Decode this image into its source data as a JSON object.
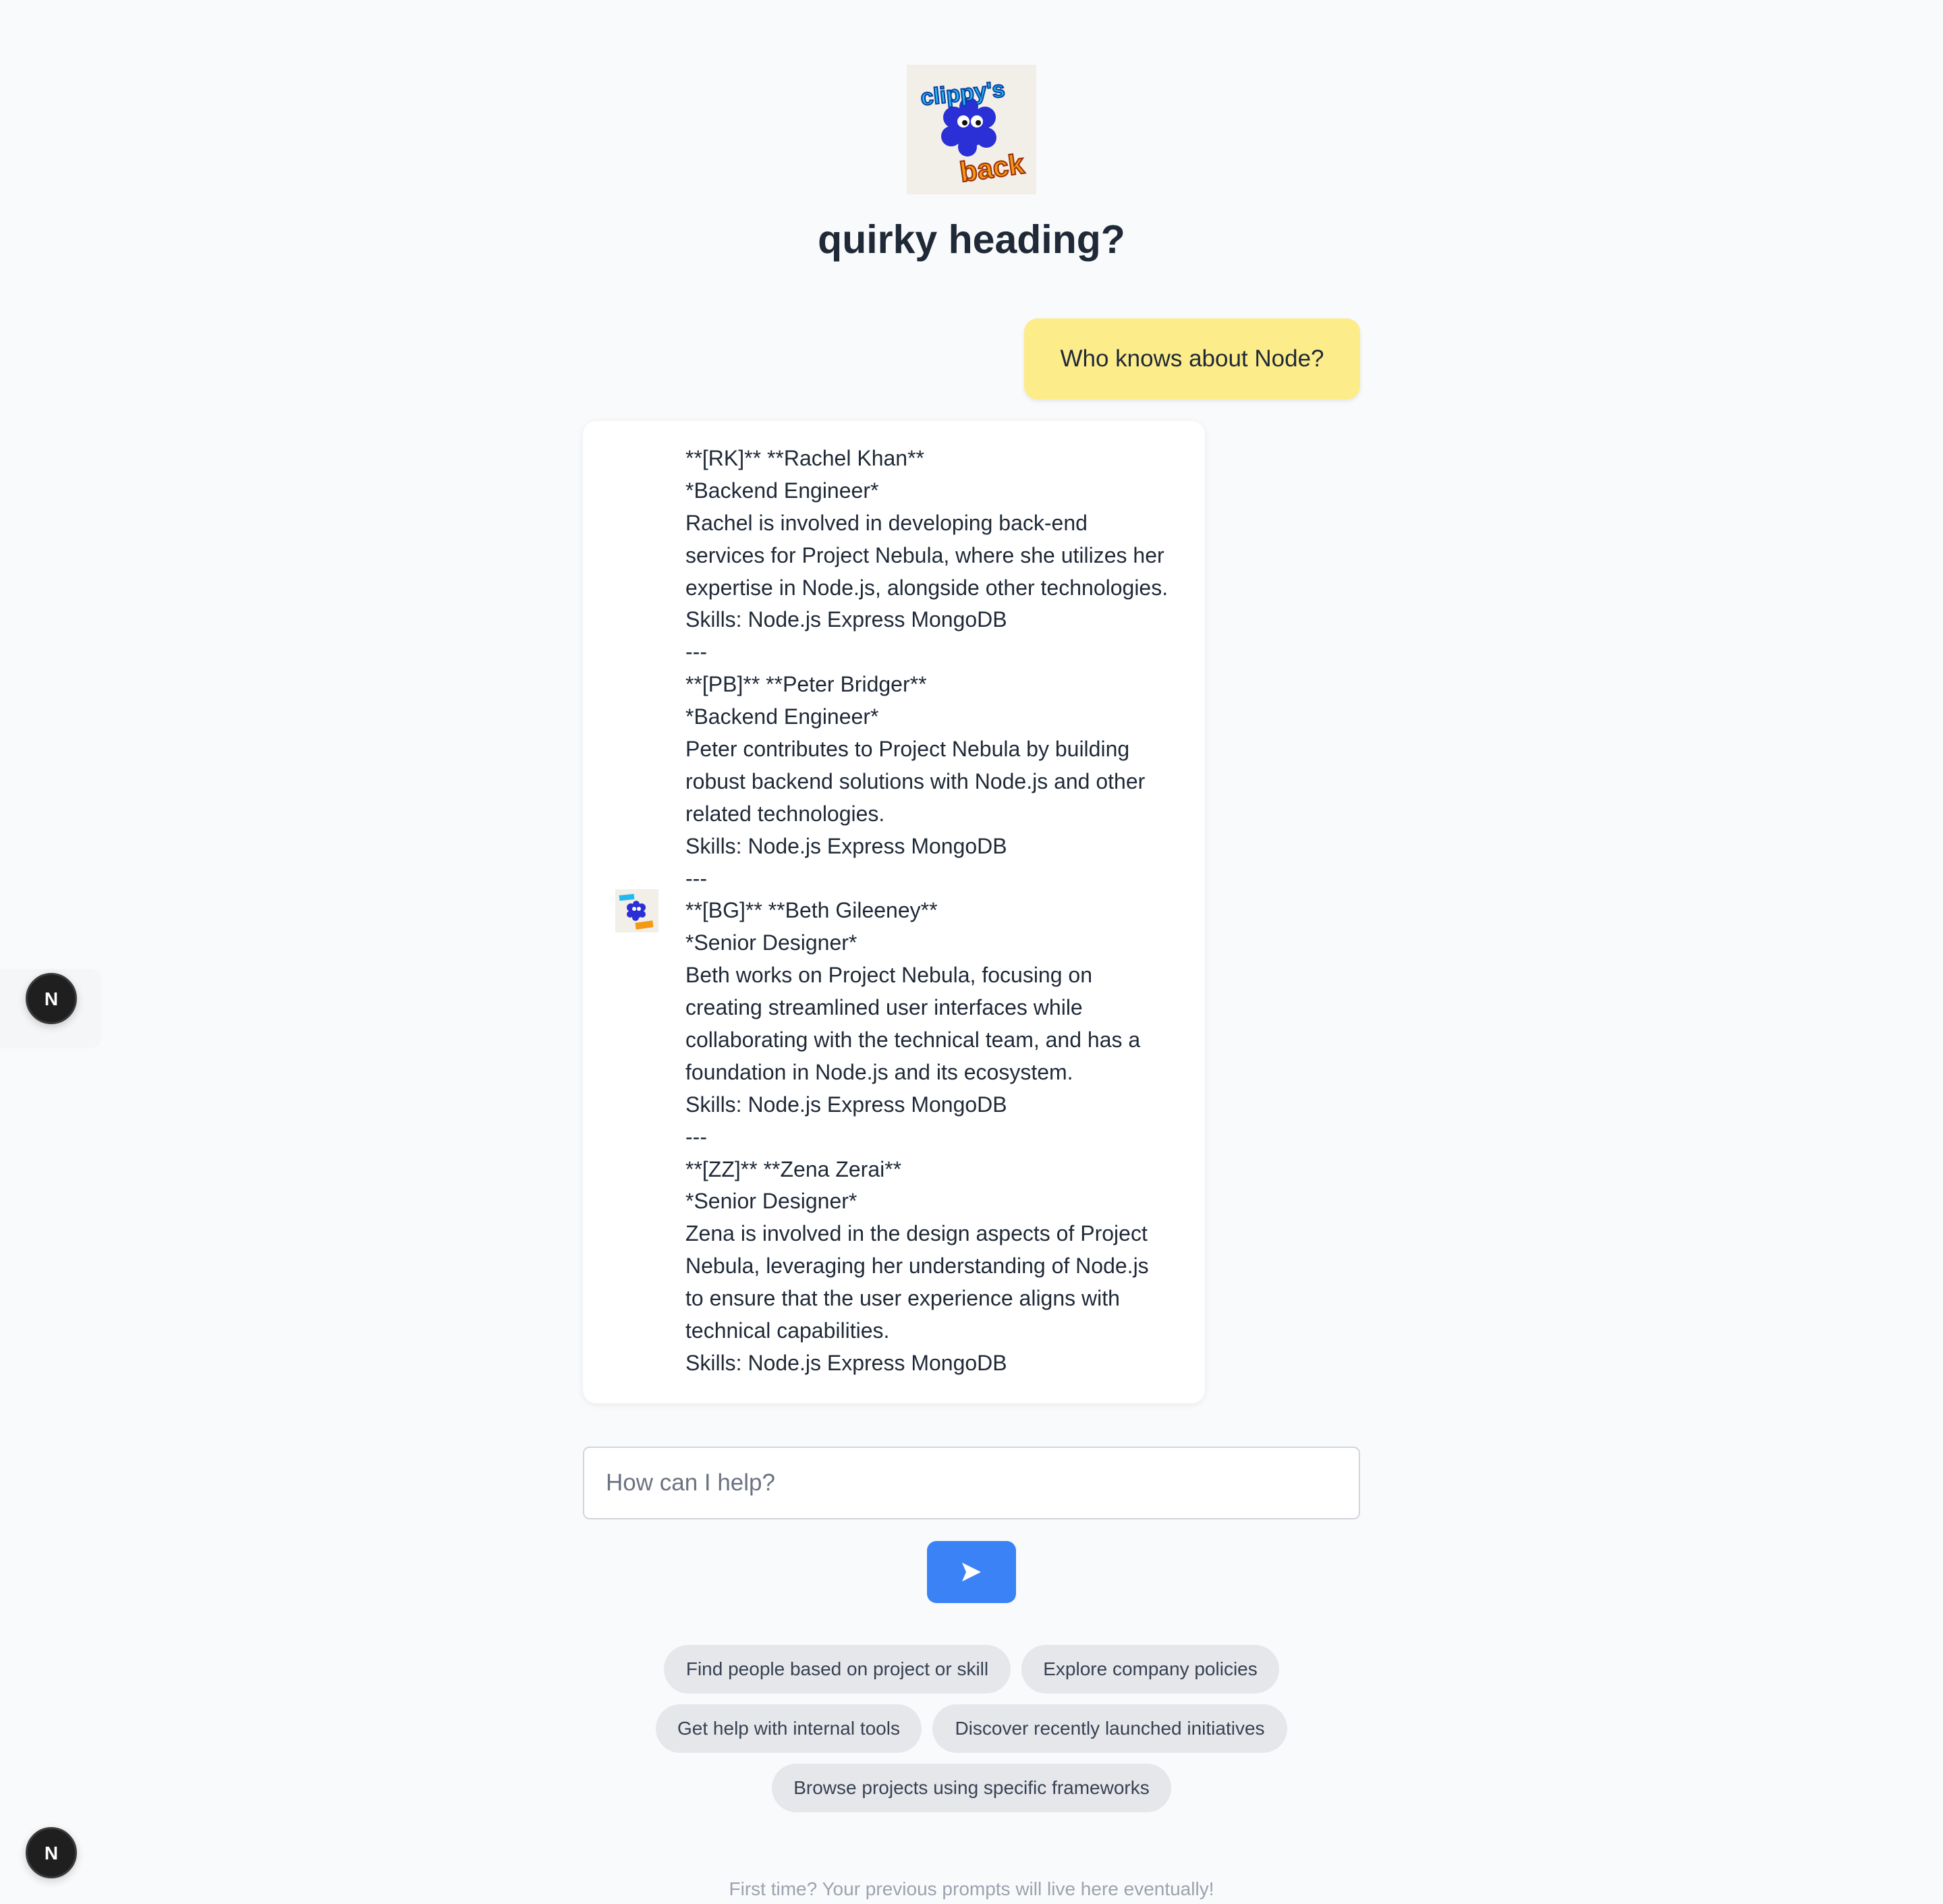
{
  "header": {
    "logo_icon": "clippy-mascot-logo",
    "logo_text_top": "clippy's",
    "logo_text_bottom": "back",
    "title": "quirky heading?"
  },
  "conversation": {
    "user_message": "Who knows about Node?",
    "assistant_avatar_icon": "clippy-mascot-avatar",
    "assistant_lines": [
      "**[RK]** **Rachel Khan**",
      "*Backend Engineer*",
      "Rachel is involved in developing back-end",
      "services for Project Nebula, where she utilizes her",
      "expertise in Node.js, alongside other technologies.",
      "Skills: Node.js Express MongoDB",
      "---",
      "**[PB]** **Peter Bridger**",
      "*Backend Engineer*",
      "Peter contributes to Project Nebula by building",
      "robust backend solutions with Node.js and other",
      "related technologies.",
      "Skills: Node.js Express MongoDB",
      "---",
      "**[BG]** **Beth Gileeney**",
      "*Senior Designer*",
      "Beth works on Project Nebula, focusing on",
      "creating streamlined user interfaces while",
      "collaborating with the technical team, and has a",
      "foundation in Node.js and its ecosystem.",
      "Skills: Node.js Express MongoDB",
      "---",
      "**[ZZ]** **Zena Zerai**",
      "*Senior Designer*",
      "Zena is involved in the design aspects of Project",
      "Nebula, leveraging her understanding of Node.js",
      "to ensure that the user experience aligns with",
      "technical capabilities.",
      "Skills: Node.js Express MongoDB"
    ]
  },
  "composer": {
    "placeholder": "How can I help?",
    "value": "",
    "send_icon": "send-arrow-icon"
  },
  "suggestions": [
    "Find people based on project or skill",
    "Explore company policies",
    "Get help with internal tools",
    "Discover recently launched initiatives",
    "Browse projects using specific frameworks"
  ],
  "footer": {
    "note": "First time? Your previous prompts will live here eventually!"
  },
  "badges": {
    "icon": "nextjs-logo-icon",
    "letter": "N"
  },
  "colors": {
    "background": "#f9fafb",
    "user_bubble": "#fdec8a",
    "send_button": "#3b82f6",
    "chip": "#e5e7eb",
    "heading": "#1f2937"
  }
}
